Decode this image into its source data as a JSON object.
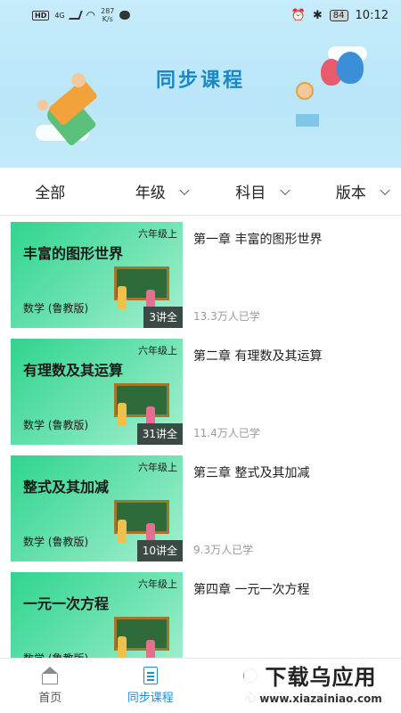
{
  "status_bar": {
    "hd": "HD",
    "network": "4G",
    "speed": "287",
    "speed_unit": "K/s",
    "battery": "84",
    "time": "10:12"
  },
  "banner": {
    "title": "同步课程"
  },
  "filters": [
    {
      "label": "全部",
      "has_dropdown": false
    },
    {
      "label": "年级",
      "has_dropdown": true
    },
    {
      "label": "科目",
      "has_dropdown": true
    },
    {
      "label": "版本",
      "has_dropdown": true
    }
  ],
  "courses": [
    {
      "thumb_title": "丰富的图形世界",
      "grade": "六年级上",
      "subject": "数学 (鲁教版)",
      "lessons": "3讲全",
      "chapter": "第一章 丰富的图形世界",
      "learners": "13.3万人已学"
    },
    {
      "thumb_title": "有理数及其运算",
      "grade": "六年级上",
      "subject": "数学 (鲁教版)",
      "lessons": "31讲全",
      "chapter": "第二章 有理数及其运算",
      "learners": "11.4万人已学"
    },
    {
      "thumb_title": "整式及其加减",
      "grade": "六年级上",
      "subject": "数学 (鲁教版)",
      "lessons": "10讲全",
      "chapter": "第三章 整式及其加减",
      "learners": "9.3万人已学"
    },
    {
      "thumb_title": "一元一次方程",
      "grade": "六年级上",
      "subject": "数学 (鲁教版)",
      "lessons": "",
      "chapter": "第四章 一元一次方程",
      "learners": ""
    }
  ],
  "bottom_nav": [
    {
      "label": "首页",
      "icon": "home-icon",
      "active": false
    },
    {
      "label": "同步课程",
      "icon": "book-icon",
      "active": true
    },
    {
      "label": "心",
      "icon": "heart-icon",
      "active": false
    },
    {
      "label": "",
      "icon": "user-icon",
      "active": false
    }
  ],
  "watermark": {
    "big": "下载乌应用",
    "small": "www.xiazainiao.com"
  }
}
